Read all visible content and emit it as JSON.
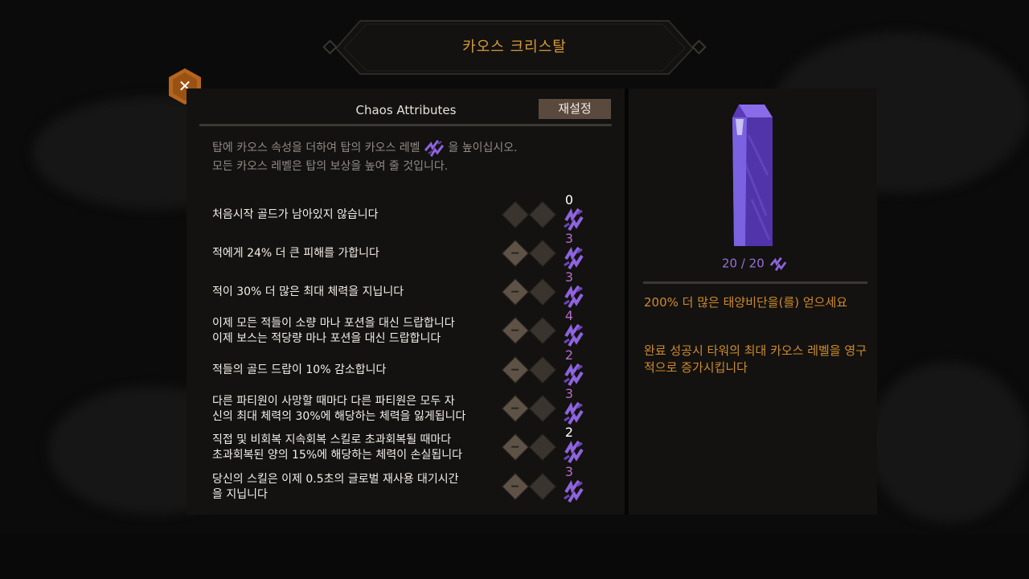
{
  "banner": {
    "title": "카오스 크리스탈"
  },
  "close": {
    "label": "✕"
  },
  "tab": {
    "title": "Chaos Attributes",
    "reset_label": "재설정"
  },
  "description": {
    "line1_before": "탑에 카오스 속성을 더하여 탑의 카오스 레벨",
    "line1_after": "을 높이십시오.",
    "line2": "모든 카오스 레벨은 탑의 보상을 높여 줄 것입니다."
  },
  "attributes": [
    {
      "text": "처음시작 골드가 남아있지 않습니다",
      "level": "0",
      "level_color": "white",
      "active": false
    },
    {
      "text": "적에게 24% 더 큰 피해를 가합니다",
      "level": "3",
      "level_color": "purple",
      "active": true
    },
    {
      "text": "적이 30% 더 많은 최대 체력을 지닙니다",
      "level": "3",
      "level_color": "purple",
      "active": true
    },
    {
      "text": "이제 모든 적들이 소량 마나 포션을 대신 드랍합니다\n이제 보스는 적당량 마나 포션을 대신 드랍합니다",
      "level": "4",
      "level_color": "purple",
      "active": true
    },
    {
      "text": "적들의 골드 드랍이 10% 감소합니다",
      "level": "2",
      "level_color": "purple",
      "active": true
    },
    {
      "text": "다른 파티원이 사망할 때마다 다른 파티원은 모두 자\n신의 최대 체력의 30%에 해당하는 체력을 잃게됩니다",
      "level": "3",
      "level_color": "purple",
      "active": true
    },
    {
      "text": "직접 및 비회복 지속회복 스킬로 초과회복될 때마다\n초과회복된 양의 15%에 해당하는 체력이 손실됩니다",
      "level": "2",
      "level_color": "white",
      "active": true
    },
    {
      "text": "당신의 스킬은 이제 0.5초의 글로벌 재사용 대기시간\n을 지닙니다",
      "level": "3",
      "level_color": "purple",
      "active": true
    }
  ],
  "crystal": {
    "counter": "20 / 20"
  },
  "rewards": [
    "200% 더 많은 태양비단을(를) 얻으세요",
    "완료 성공시 타워의 최대 카오스 레벨을 영구적으로 증가시킵니다"
  ],
  "colors": {
    "accent_gold": "#d89a3a",
    "chaos_purple": "#8f63e0",
    "close_orange": "#b5651d"
  },
  "icons": {
    "chaos_rune": "chaos-rune-icon",
    "close": "close-icon"
  }
}
